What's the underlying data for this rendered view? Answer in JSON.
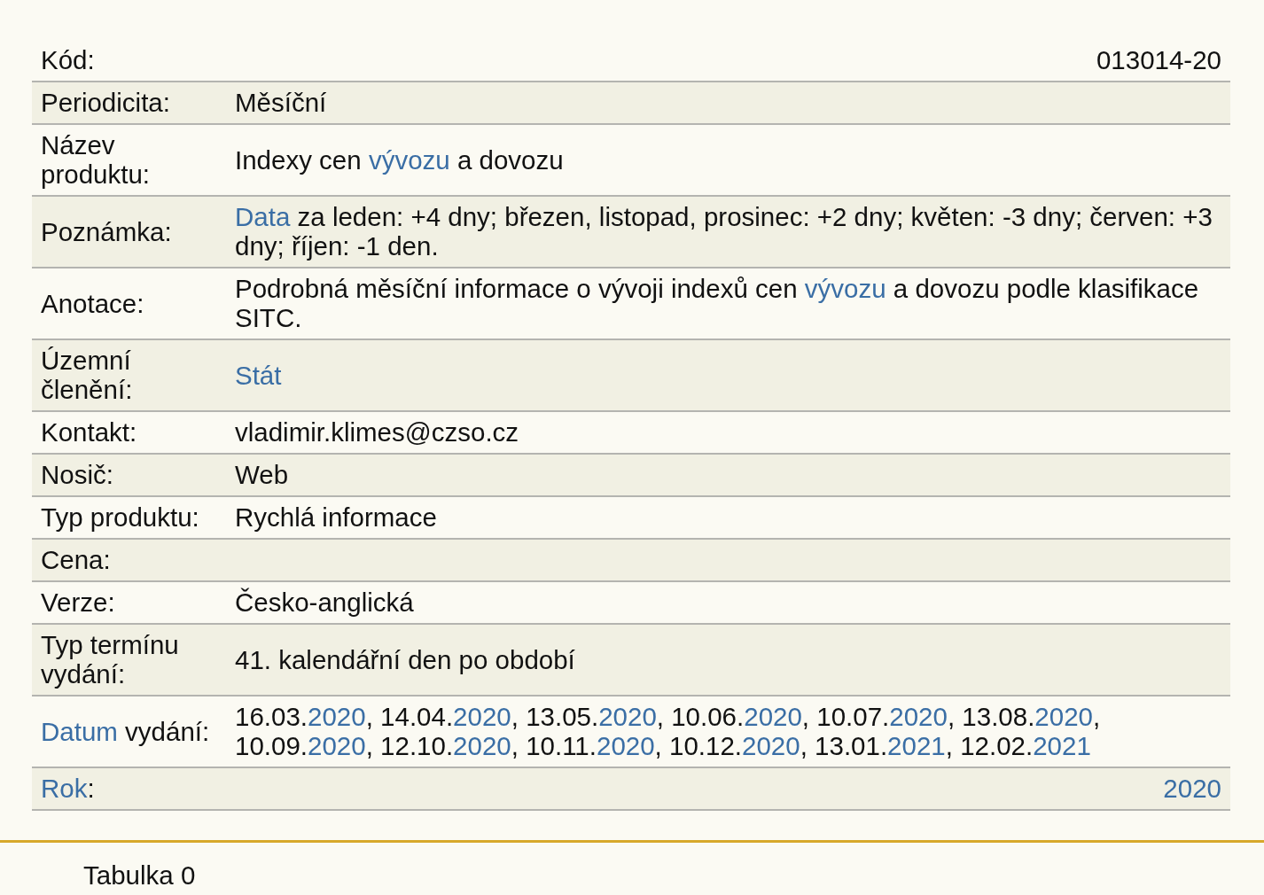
{
  "rows": [
    {
      "kind": "split",
      "label": [
        {
          "text": "Kód:",
          "link": false
        }
      ],
      "value": [
        {
          "text": "013014-20",
          "link": false
        }
      ]
    },
    {
      "kind": "pair",
      "label": [
        {
          "text": "Periodicita:",
          "link": false
        }
      ],
      "value": [
        {
          "text": "Měsíční",
          "link": false
        }
      ]
    },
    {
      "kind": "pair",
      "label": [
        {
          "text": "Název produktu:",
          "link": false
        }
      ],
      "value": [
        {
          "text": "Indexy cen ",
          "link": false
        },
        {
          "text": "vývozu",
          "link": true
        },
        {
          "text": " a dovozu",
          "link": false
        }
      ]
    },
    {
      "kind": "pair",
      "label": [
        {
          "text": "Poznámka:",
          "link": false
        }
      ],
      "value": [
        {
          "text": "Data",
          "link": true
        },
        {
          "text": " za leden: +4 dny; březen, listopad, prosinec: +2 dny; květen: -3 dny; červen: +3 dny; říjen: -1 den.",
          "link": false
        }
      ]
    },
    {
      "kind": "pair",
      "label": [
        {
          "text": "Anotace:",
          "link": false
        }
      ],
      "value": [
        {
          "text": "Podrobná měsíční informace o vývoji indexů cen ",
          "link": false
        },
        {
          "text": "vývozu",
          "link": true
        },
        {
          "text": " a dovozu podle klasifikace SITC.",
          "link": false
        }
      ]
    },
    {
      "kind": "pair",
      "label": [
        {
          "text": "Územní členění:",
          "link": false
        }
      ],
      "value": [
        {
          "text": "Stát",
          "link": true
        }
      ]
    },
    {
      "kind": "pair",
      "label": [
        {
          "text": "Kontakt:",
          "link": false
        }
      ],
      "value": [
        {
          "text": "vladimir.klimes@czso.cz",
          "link": false
        }
      ]
    },
    {
      "kind": "pair",
      "label": [
        {
          "text": "Nosič:",
          "link": false
        }
      ],
      "value": [
        {
          "text": "Web",
          "link": false
        }
      ]
    },
    {
      "kind": "pair",
      "label": [
        {
          "text": "Typ produktu:",
          "link": false
        }
      ],
      "value": [
        {
          "text": "Rychlá informace",
          "link": false
        }
      ]
    },
    {
      "kind": "pair",
      "label": [
        {
          "text": "Cena:",
          "link": false
        }
      ]
    },
    {
      "kind": "pair",
      "label": [
        {
          "text": "Verze:",
          "link": false
        }
      ],
      "value": [
        {
          "text": "Česko-anglická",
          "link": false
        }
      ]
    },
    {
      "kind": "pair",
      "label": [
        {
          "text": "Typ termínu vydání:",
          "link": false
        }
      ],
      "value": [
        {
          "text": "41. kalendářní den po období",
          "link": false
        }
      ]
    },
    {
      "kind": "pair",
      "label": [
        {
          "text": "Datum",
          "link": true
        },
        {
          "text": " vydání:",
          "link": false
        }
      ],
      "value": [
        {
          "text": "16.03.",
          "link": false
        },
        {
          "text": "2020",
          "link": true
        },
        {
          "text": ", 14.04.",
          "link": false
        },
        {
          "text": "2020",
          "link": true
        },
        {
          "text": ", 13.05.",
          "link": false
        },
        {
          "text": "2020",
          "link": true
        },
        {
          "text": ", 10.06.",
          "link": false
        },
        {
          "text": "2020",
          "link": true
        },
        {
          "text": ", 10.07.",
          "link": false
        },
        {
          "text": "2020",
          "link": true
        },
        {
          "text": ", 13.08.",
          "link": false
        },
        {
          "text": "2020",
          "link": true
        },
        {
          "text": ", 10.09.",
          "link": false
        },
        {
          "text": "2020",
          "link": true
        },
        {
          "text": ", 12.10.",
          "link": false
        },
        {
          "text": "2020",
          "link": true
        },
        {
          "text": ", 10.11.",
          "link": false
        },
        {
          "text": "2020",
          "link": true
        },
        {
          "text": ", 10.12.",
          "link": false
        },
        {
          "text": "2020",
          "link": true
        },
        {
          "text": ", 13.01.",
          "link": false
        },
        {
          "text": "2021",
          "link": true
        },
        {
          "text": ", 12.02.",
          "link": false
        },
        {
          "text": "2021",
          "link": true
        }
      ]
    },
    {
      "kind": "split",
      "label": [
        {
          "text": "Rok",
          "link": true
        },
        {
          "text": ":",
          "link": false
        }
      ],
      "value": [
        {
          "text": "2020",
          "link": true
        }
      ]
    }
  ],
  "caption": "Tabulka 0"
}
